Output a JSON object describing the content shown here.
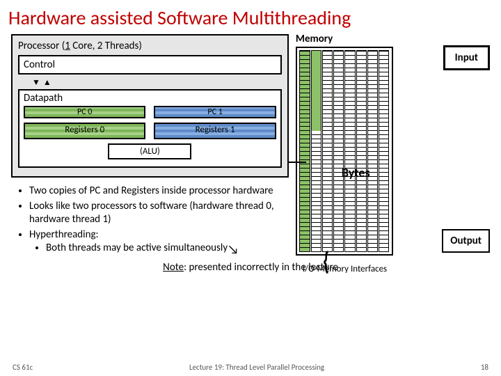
{
  "title": "Hardware assisted Software Multithreading",
  "processor": {
    "title_prefix": "Processor (",
    "title_underlined": "1",
    "title_suffix": " Core, 2 Threads)",
    "control": "Control",
    "datapath": "Datapath",
    "pc0": "PC 0",
    "pc1": "PC 1",
    "reg0": "Registers 0",
    "reg1": "Registers 1",
    "alu": "(ALU)"
  },
  "memory": {
    "label": "Memory",
    "bytes": "Bytes"
  },
  "io": {
    "input": "Input",
    "output": "Output",
    "interfaces": "I/O-Memory Interfaces"
  },
  "bullets": {
    "b1": "Two copies of PC and Registers inside processor hardware",
    "b2": "Looks like two processors to software (hardware thread 0, hardware thread 1)",
    "b3": "Hyperthreading:",
    "b3a": "Both threads may be active simultaneously"
  },
  "note_prefix": "Note",
  "note_rest": ": presented incorrectly in the lecture",
  "footer": {
    "left": "CS 61c",
    "mid": "Lecture 19: Thread Level Parallel Processing",
    "right": "18"
  }
}
